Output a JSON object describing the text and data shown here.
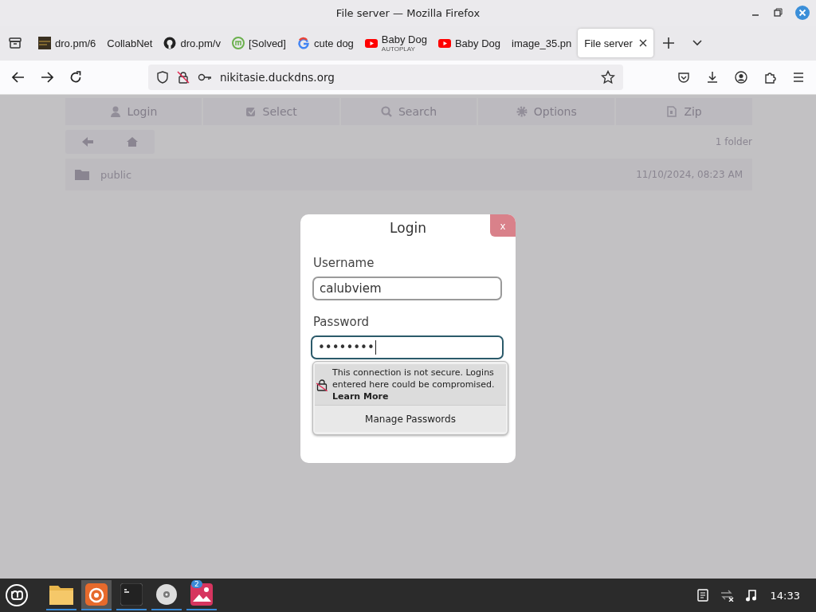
{
  "window": {
    "title": "File server — Mozilla Firefox"
  },
  "tabs": [
    {
      "label": "dro.pm/6",
      "kind": "thumb",
      "selected": false
    },
    {
      "label": "CollabNet",
      "kind": "none",
      "selected": false
    },
    {
      "label": "dro.pm/v",
      "kind": "github",
      "selected": false
    },
    {
      "label": "[Solved]",
      "kind": "mint",
      "selected": false
    },
    {
      "label": "cute dog",
      "kind": "google",
      "selected": false
    },
    {
      "label": "Baby Dog",
      "sublabel": "AUTOPLAY",
      "kind": "youtube",
      "selected": false
    },
    {
      "label": "Baby Dog",
      "kind": "youtube",
      "selected": false
    },
    {
      "label": "image_35.pn",
      "kind": "none",
      "selected": false
    },
    {
      "label": "File server",
      "kind": "none",
      "selected": true
    }
  ],
  "address": {
    "url": "nikitasie.duckdns.org"
  },
  "page": {
    "toolbar": [
      {
        "label": "Login",
        "kind": "user"
      },
      {
        "label": "Select",
        "kind": "check"
      },
      {
        "label": "Search",
        "kind": "search"
      },
      {
        "label": "Options",
        "kind": "gear"
      },
      {
        "label": "Zip",
        "kind": "zip"
      }
    ],
    "folder_count": "1 folder",
    "rows": [
      {
        "name": "public",
        "date": "11/10/2024, 08:23 AM"
      }
    ]
  },
  "dialog": {
    "title": "Login",
    "close": "x",
    "username_label": "Username",
    "username": "calubviem",
    "password_label": "Password",
    "password": "••••••••"
  },
  "popup": {
    "warning": "This connection is not secure. Logins entered here could be compromised. **Learn More**",
    "manage": "Manage Passwords"
  },
  "taskbar": {
    "apps": [
      {
        "kind": "files",
        "active": false
      },
      {
        "kind": "firefox",
        "active": true
      },
      {
        "kind": "terminal",
        "active": false
      },
      {
        "kind": "disc",
        "active": false
      },
      {
        "kind": "photos",
        "active": false,
        "badge": "2"
      }
    ],
    "clock": "14:33"
  }
}
